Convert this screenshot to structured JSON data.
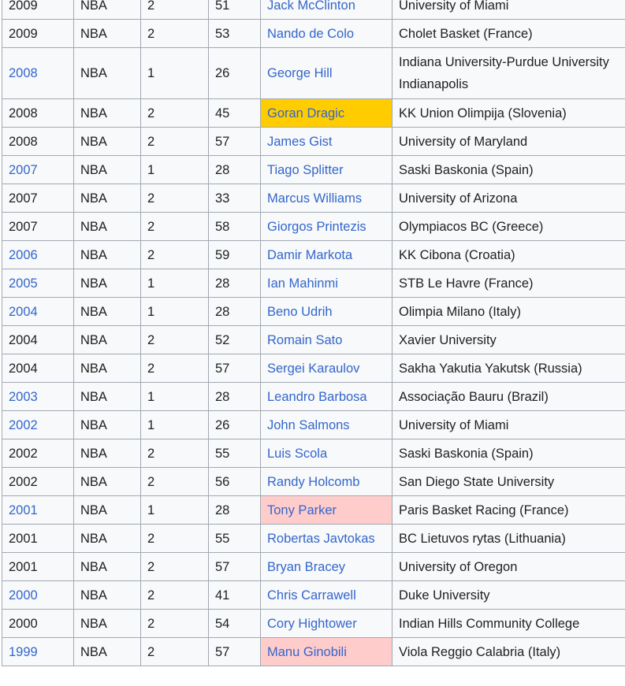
{
  "table": {
    "rows": [
      {
        "year": "2009",
        "year_link": false,
        "league": "NBA",
        "round": "2",
        "pick": "51",
        "player": "Jack McClinton",
        "school": "University of Miami",
        "highlight": ""
      },
      {
        "year": "2009",
        "year_link": false,
        "league": "NBA",
        "round": "2",
        "pick": "53",
        "player": "Nando de Colo",
        "school": "Cholet Basket (France)",
        "highlight": ""
      },
      {
        "year": "2008",
        "year_link": true,
        "league": "NBA",
        "round": "1",
        "pick": "26",
        "player": "George Hill",
        "school": "Indiana University-Purdue University Indianapolis",
        "highlight": "",
        "tall": true
      },
      {
        "year": "2008",
        "year_link": false,
        "league": "NBA",
        "round": "2",
        "pick": "45",
        "player": "Goran Dragic",
        "school": "KK Union Olimpija (Slovenia)",
        "highlight": "#ffcc00"
      },
      {
        "year": "2008",
        "year_link": false,
        "league": "NBA",
        "round": "2",
        "pick": "57",
        "player": "James Gist",
        "school": "University of Maryland",
        "highlight": ""
      },
      {
        "year": "2007",
        "year_link": true,
        "league": "NBA",
        "round": "1",
        "pick": "28",
        "player": "Tiago Splitter",
        "school": "Saski Baskonia (Spain)",
        "highlight": ""
      },
      {
        "year": "2007",
        "year_link": false,
        "league": "NBA",
        "round": "2",
        "pick": "33",
        "player": "Marcus Williams",
        "school": "University of Arizona",
        "highlight": ""
      },
      {
        "year": "2007",
        "year_link": false,
        "league": "NBA",
        "round": "2",
        "pick": "58",
        "player": "Giorgos Printezis",
        "school": "Olympiacos BC (Greece)",
        "highlight": ""
      },
      {
        "year": "2006",
        "year_link": true,
        "league": "NBA",
        "round": "2",
        "pick": "59",
        "player": "Damir Markota",
        "school": "KK Cibona (Croatia)",
        "highlight": ""
      },
      {
        "year": "2005",
        "year_link": true,
        "league": "NBA",
        "round": "1",
        "pick": "28",
        "player": "Ian Mahinmi",
        "school": "STB Le Havre (France)",
        "highlight": ""
      },
      {
        "year": "2004",
        "year_link": true,
        "league": "NBA",
        "round": "1",
        "pick": "28",
        "player": "Beno Udrih",
        "school": "Olimpia Milano (Italy)",
        "highlight": ""
      },
      {
        "year": "2004",
        "year_link": false,
        "league": "NBA",
        "round": "2",
        "pick": "52",
        "player": "Romain Sato",
        "school": "Xavier University",
        "highlight": ""
      },
      {
        "year": "2004",
        "year_link": false,
        "league": "NBA",
        "round": "2",
        "pick": "57",
        "player": "Sergei Karaulov",
        "school": "Sakha Yakutia Yakutsk (Russia)",
        "highlight": ""
      },
      {
        "year": "2003",
        "year_link": true,
        "league": "NBA",
        "round": "1",
        "pick": "28",
        "player": "Leandro Barbosa",
        "school": "Associação Bauru (Brazil)",
        "highlight": ""
      },
      {
        "year": "2002",
        "year_link": true,
        "league": "NBA",
        "round": "1",
        "pick": "26",
        "player": "John Salmons",
        "school": "University of Miami",
        "highlight": ""
      },
      {
        "year": "2002",
        "year_link": false,
        "league": "NBA",
        "round": "2",
        "pick": "55",
        "player": "Luis Scola",
        "school": "Saski Baskonia (Spain)",
        "highlight": ""
      },
      {
        "year": "2002",
        "year_link": false,
        "league": "NBA",
        "round": "2",
        "pick": "56",
        "player": "Randy Holcomb",
        "school": "San Diego State University",
        "highlight": ""
      },
      {
        "year": "2001",
        "year_link": true,
        "league": "NBA",
        "round": "1",
        "pick": "28",
        "player": "Tony Parker",
        "school": "Paris Basket Racing (France)",
        "highlight": "#ffcccc"
      },
      {
        "year": "2001",
        "year_link": false,
        "league": "NBA",
        "round": "2",
        "pick": "55",
        "player": "Robertas Javtokas",
        "school": "BC Lietuvos rytas (Lithuania)",
        "highlight": ""
      },
      {
        "year": "2001",
        "year_link": false,
        "league": "NBA",
        "round": "2",
        "pick": "57",
        "player": "Bryan Bracey",
        "school": "University of Oregon",
        "highlight": ""
      },
      {
        "year": "2000",
        "year_link": true,
        "league": "NBA",
        "round": "2",
        "pick": "41",
        "player": "Chris Carrawell",
        "school": "Duke University",
        "highlight": ""
      },
      {
        "year": "2000",
        "year_link": false,
        "league": "NBA",
        "round": "2",
        "pick": "54",
        "player": "Cory Hightower",
        "school": "Indian Hills Community College",
        "highlight": ""
      },
      {
        "year": "1999",
        "year_link": true,
        "league": "NBA",
        "round": "2",
        "pick": "57",
        "player": "Manu Ginobili",
        "school": "Viola Reggio Calabria (Italy)",
        "highlight": "#ffcccc"
      }
    ]
  },
  "colors": {
    "link": "#3366cc",
    "text": "#202122",
    "border": "#a2a9b1",
    "row_bg": "#f8f9fa",
    "highlight_gold": "#ffcc00",
    "highlight_pink": "#ffcccc"
  }
}
